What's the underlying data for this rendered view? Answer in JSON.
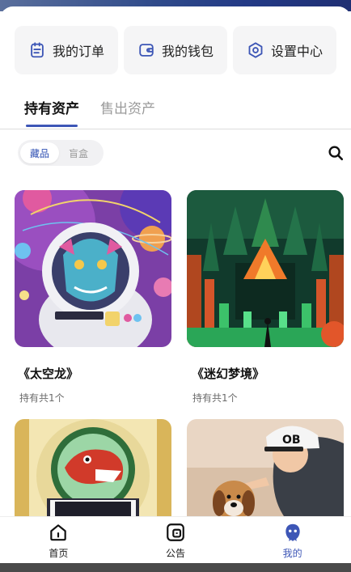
{
  "quick_actions": [
    {
      "label": "我的订单",
      "icon": "order-icon"
    },
    {
      "label": "我的钱包",
      "icon": "wallet-icon"
    },
    {
      "label": "设置中心",
      "icon": "settings-icon"
    }
  ],
  "tabs": [
    {
      "label": "持有资产",
      "active": true
    },
    {
      "label": "售出资产",
      "active": false
    }
  ],
  "filters": [
    {
      "label": "藏品",
      "active": true
    },
    {
      "label": "盲盒",
      "active": false
    }
  ],
  "items": [
    {
      "title": "《太空龙》",
      "count": "持有共1个"
    },
    {
      "title": "《迷幻梦境》",
      "count": "持有共1个"
    },
    {
      "title": "",
      "count": "",
      "badge_text": "OB"
    },
    {
      "title": "",
      "count": ""
    }
  ],
  "bottom_nav": [
    {
      "label": "首页",
      "icon": "home-icon",
      "active": false
    },
    {
      "label": "公告",
      "icon": "announcement-icon",
      "active": false
    },
    {
      "label": "我的",
      "icon": "profile-icon",
      "active": true
    }
  ],
  "colors": {
    "accent": "#3d56b6",
    "muted": "#9a9a9a",
    "pill_bg": "#f1f1f3"
  }
}
